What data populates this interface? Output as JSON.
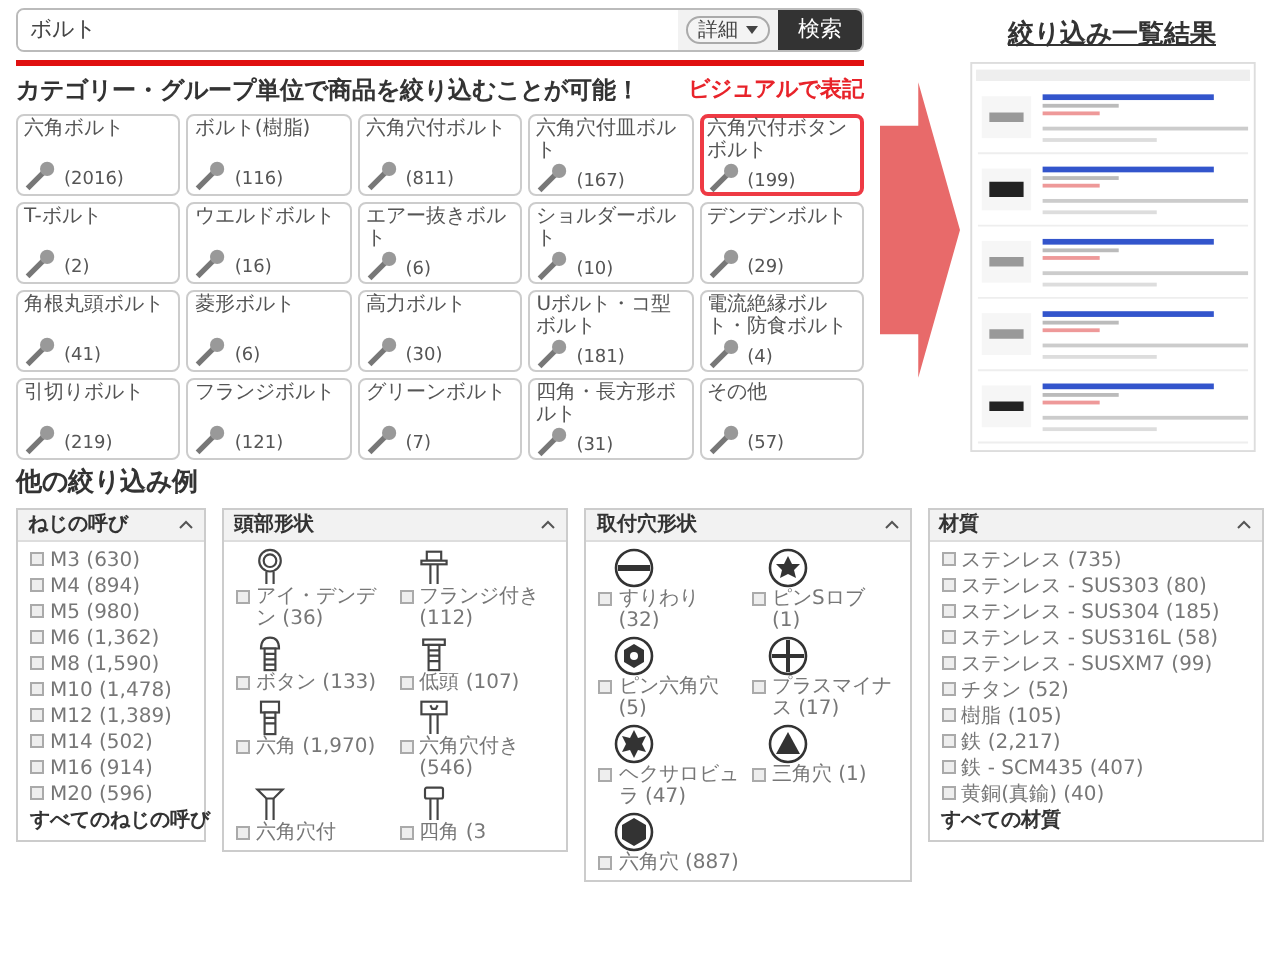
{
  "search": {
    "value": "ボルト",
    "detail_button": "詳細",
    "search_button": "検索"
  },
  "heading": "カテゴリー・グループ単位で商品を絞り込むことが可能！",
  "callout": "ビジュアルで表記",
  "categories": [
    {
      "name": "六角ボルト",
      "count": "(2016)",
      "selected": false
    },
    {
      "name": "ボルト(樹脂)",
      "count": "(116)",
      "selected": false
    },
    {
      "name": "六角穴付ボルト",
      "count": "(811)",
      "selected": false
    },
    {
      "name": "六角穴付皿ボルト",
      "count": "(167)",
      "selected": false
    },
    {
      "name": "六角穴付ボタンボルト",
      "count": "(199)",
      "selected": true
    },
    {
      "name": "T-ボルト",
      "count": "(2)",
      "selected": false
    },
    {
      "name": "ウエルドボルト",
      "count": "(16)",
      "selected": false
    },
    {
      "name": "エアー抜きボルト",
      "count": "(6)",
      "selected": false
    },
    {
      "name": "ショルダーボルト",
      "count": "(10)",
      "selected": false
    },
    {
      "name": "デンデンボルト",
      "count": "(29)",
      "selected": false
    },
    {
      "name": "角根丸頭ボルト",
      "count": "(41)",
      "selected": false
    },
    {
      "name": "菱形ボルト",
      "count": "(6)",
      "selected": false
    },
    {
      "name": "高力ボルト",
      "count": "(30)",
      "selected": false
    },
    {
      "name": "Uボルト・コ型ボルト",
      "count": "(181)",
      "selected": false
    },
    {
      "name": "電流絶縁ボルト・防食ボルト",
      "count": "(4)",
      "selected": false
    },
    {
      "name": "引切りボルト",
      "count": "(219)",
      "selected": false
    },
    {
      "name": "フランジボルト",
      "count": "(121)",
      "selected": false
    },
    {
      "name": "グリーンボルト",
      "count": "(7)",
      "selected": false
    },
    {
      "name": "四角・長方形ボルト",
      "count": "(31)",
      "selected": false
    },
    {
      "name": "その他",
      "count": "(57)",
      "selected": false
    }
  ],
  "results_title": "絞り込み一覧結果",
  "other_filters_title": "他の絞り込み例",
  "filters": [
    {
      "kind": "list",
      "title": "ねじの呼び",
      "expanded": true,
      "items": [
        {
          "label": "M3 (630)",
          "checked": false
        },
        {
          "label": "M4 (894)",
          "checked": false
        },
        {
          "label": "M5 (980)",
          "checked": false
        },
        {
          "label": "M6 (1,362)",
          "checked": false
        },
        {
          "label": "M8 (1,590)",
          "checked": false
        },
        {
          "label": "M10 (1,478)",
          "checked": false
        },
        {
          "label": "M12 (1,389)",
          "checked": false
        },
        {
          "label": "M14 (502)",
          "checked": false
        },
        {
          "label": "M16 (914)",
          "checked": false
        },
        {
          "label": "M20 (596)",
          "checked": false
        }
      ],
      "footer": "すべてのねじの呼び"
    },
    {
      "kind": "heads",
      "title": "頭部形状",
      "expanded": true,
      "items": [
        {
          "label": "アイ・デンデン (36)",
          "checked": false
        },
        {
          "label": "フランジ付き (112)",
          "checked": false
        },
        {
          "label": "ボタン (133)",
          "checked": false
        },
        {
          "label": "低頭 (107)",
          "checked": false
        },
        {
          "label": "六角 (1,970)",
          "checked": false
        },
        {
          "label": "六角穴付き (546)",
          "checked": false
        },
        {
          "label": "六角穴付",
          "checked": false
        },
        {
          "label": "四角 (3",
          "checked": false
        }
      ]
    },
    {
      "kind": "holes",
      "title": "取付穴形状",
      "expanded": true,
      "items": [
        {
          "label": "すりわり (32)",
          "checked": false
        },
        {
          "label": "ピンSロブ (1)",
          "checked": false
        },
        {
          "label": "ピン六角穴 (5)",
          "checked": false
        },
        {
          "label": "プラスマイナス (17)",
          "checked": false
        },
        {
          "label": "ヘクサロビュラ (47)",
          "checked": false
        },
        {
          "label": "三角穴 (1)",
          "checked": false
        },
        {
          "label": "六角穴 (887)",
          "checked": false
        }
      ]
    },
    {
      "kind": "list",
      "title": "材質",
      "expanded": true,
      "items": [
        {
          "label": "ステンレス (735)",
          "checked": false
        },
        {
          "label": "ステンレス - SUS303 (80)",
          "checked": false
        },
        {
          "label": "ステンレス - SUS304 (185)",
          "checked": false
        },
        {
          "label": "ステンレス - SUS316L (58)",
          "checked": false
        },
        {
          "label": "ステンレス - SUSXM7 (99)",
          "checked": false
        },
        {
          "label": "チタン (52)",
          "checked": false
        },
        {
          "label": "樹脂 (105)",
          "checked": false
        },
        {
          "label": "鉄 (2,217)",
          "checked": false
        },
        {
          "label": "鉄 - SCM435 (407)",
          "checked": false
        },
        {
          "label": "黄銅(真鍮) (40)",
          "checked": false
        }
      ],
      "footer": "すべての材質"
    }
  ]
}
